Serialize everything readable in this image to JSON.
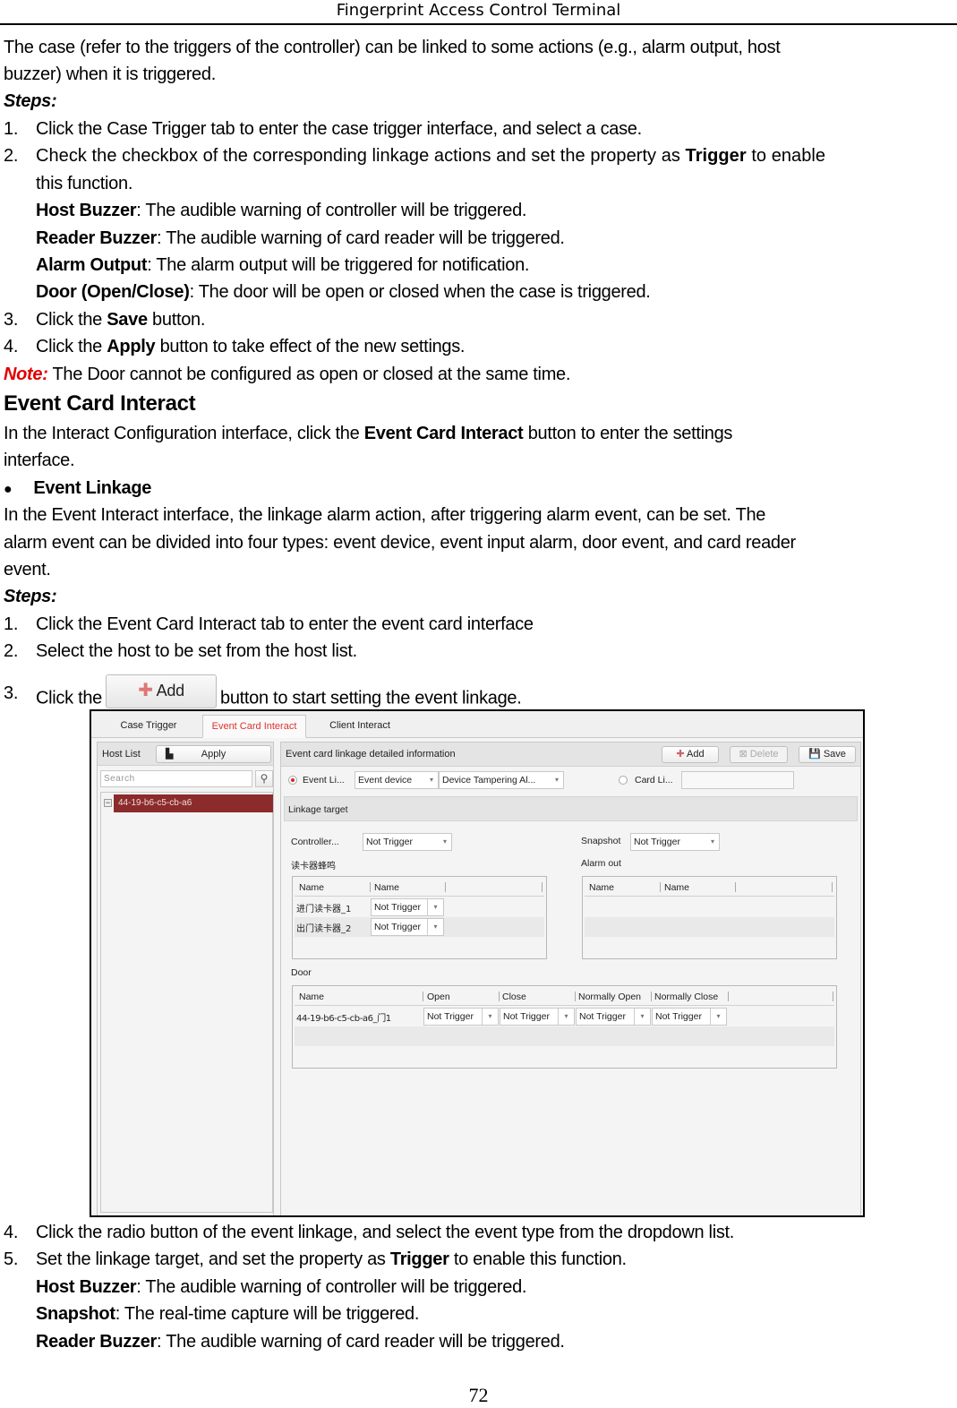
{
  "header": {
    "title": "Fingerprint Access Control Terminal"
  },
  "intro": {
    "line1": "The case (refer to the triggers of the controller) can be linked to some actions (e.g., alarm output, host",
    "line2": "buzzer) when it is triggered."
  },
  "case_steps": {
    "label": "Steps:",
    "s1_num": "1.",
    "s1": "Click the Case Trigger tab to enter the case trigger interface, and select a case.",
    "s2_num": "2.",
    "s2_pre": "Check the checkbox of the corresponding linkage actions and set the property as",
    "s2_bold": "Trigger",
    "s2_post": "to enable",
    "s2_line2": "this function.",
    "defs": [
      {
        "term": "Host Buzzer",
        "desc": ": The audible warning of controller will be triggered."
      },
      {
        "term": "Reader Buzzer",
        "desc": ": The audible warning of card reader will be triggered."
      },
      {
        "term": "Alarm Output",
        "desc": ": The alarm output will be triggered for notification."
      },
      {
        "term": "Door (Open/Close)",
        "desc": ": The door will be open or closed when the case is triggered."
      }
    ],
    "s3_num": "3.",
    "s3_pre": "Click the",
    "s3_bold": "Save",
    "s3_post": "button.",
    "s4_num": "4.",
    "s4_pre": "Click the",
    "s4_bold": "Apply",
    "s4_post": "button to take effect of the new settings."
  },
  "note": {
    "label": "Note:",
    "text": " The Door cannot be configured as open or closed at the same time."
  },
  "section": {
    "title": "Event Card Interact",
    "p1_pre": "In the Interact Configuration interface, click the",
    "p1_bold": "Event Card Interact",
    "p1_post": "button to enter the settings",
    "p1_line2": "interface.",
    "bullet": "Event Linkage",
    "p2_line1": "In the Event Interact interface, the linkage alarm action, after triggering alarm event, can be set. The",
    "p2_line2": "alarm event can be divided into four types: event device, event input alarm, door event, and card reader",
    "p2_line3": "event."
  },
  "event_steps": {
    "label": "Steps:",
    "s1_num": "1.",
    "s1": "Click the Event Card Interact tab to enter the event card interface",
    "s2_num": "2.",
    "s2": "Select the host to be set from the host list.",
    "s3_num": "3.",
    "s3_pre": "Click the",
    "s3_button": "Add",
    "s3_post": "button to start setting the event linkage.",
    "s4_num": "4.",
    "s4": "Click the radio button of the event linkage, and select the event type from the dropdown list.",
    "s5_num": "5.",
    "s5_pre": "Set the linkage target, and set the property as",
    "s5_bold": "Trigger",
    "s5_post": "to enable this function.",
    "defs": [
      {
        "term": "Host Buzzer",
        "desc": ": The audible warning of controller will be triggered."
      },
      {
        "term": "Snapshot",
        "desc": ": The real-time capture will be triggered."
      },
      {
        "term": "Reader Buzzer",
        "desc": ": The audible warning of card reader will be triggered."
      }
    ]
  },
  "app": {
    "tabs": [
      "Case Trigger",
      "Event Card Interact",
      "Client Interact"
    ],
    "active_tab": "Event Card Interact",
    "host_list": {
      "title": "Host List",
      "apply": "Apply",
      "search_placeholder": "Search",
      "hosts": [
        "44-19-b6-c5-cb-a6"
      ]
    },
    "detail": {
      "title": "Event card linkage detailed information",
      "add": "Add",
      "delete": "Delete",
      "save": "Save",
      "event_linkage_radio": "Event Li...",
      "event_type": "Event device",
      "event_name": "Device Tampering Al...",
      "card_linkage_radio": "Card Li...",
      "card_value": "",
      "linkage_target": "Linkage target",
      "controller_label": "Controller...",
      "controller_value": "Not Trigger",
      "snapshot_label": "Snapshot",
      "snapshot_value": "Not Trigger",
      "reader_buzzer_label": "读卡器蜂鸣",
      "reader_table": {
        "columns": [
          "Name",
          "Name"
        ],
        "rows": [
          {
            "name": "进门读卡器_1",
            "value": "Not Trigger"
          },
          {
            "name": "出门读卡器_2",
            "value": "Not Trigger"
          }
        ]
      },
      "alarm_out_label": "Alarm out",
      "alarm_table": {
        "columns": [
          "Name",
          "Name"
        ],
        "rows": []
      },
      "door_label": "Door",
      "door_table": {
        "columns": [
          "Name",
          "Open",
          "Close",
          "Normally Open",
          "Normally Close"
        ],
        "rows": [
          {
            "name": "44-19-b6-c5-cb-a6_门1",
            "open": "Not Trigger",
            "close": "Not Trigger",
            "normally_open": "Not Trigger",
            "normally_close": "Not Trigger"
          }
        ]
      }
    }
  },
  "footer": {
    "page": "72"
  },
  "colors": {
    "accent_red": "#e03030",
    "selected_host": "#8b2b2b",
    "note_red": "#e00000"
  }
}
